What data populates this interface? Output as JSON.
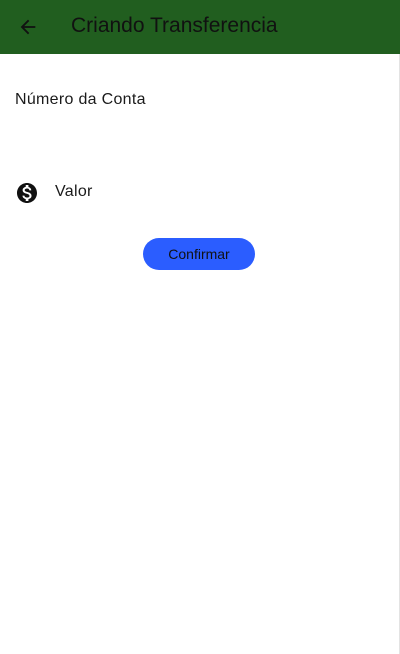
{
  "app_bar": {
    "title": "Criando Transferencia",
    "back_icon": "arrow-back-icon",
    "background_color": "#215e1f"
  },
  "form": {
    "account_number": {
      "label": "Número da Conta"
    },
    "amount": {
      "label": "Valor",
      "icon": "dollar-circle-icon"
    },
    "confirm_button": {
      "label": "Confirmar",
      "color": "#2b5dff"
    }
  }
}
